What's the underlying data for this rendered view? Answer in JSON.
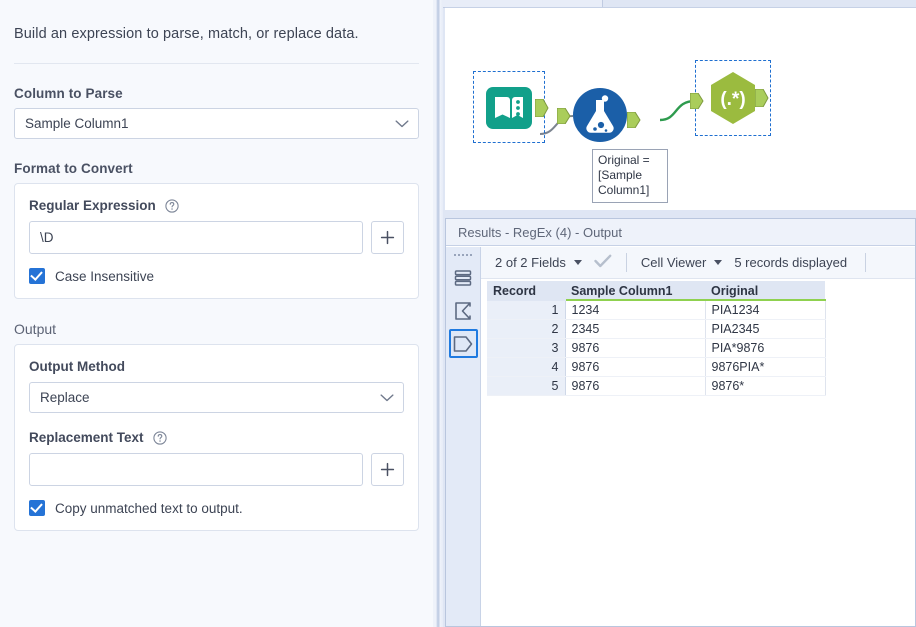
{
  "config_panel": {
    "intro_text": "Build an expression to parse, match, or replace data.",
    "column_to_parse": {
      "label": "Column to Parse",
      "value": "Sample Column1",
      "chevron_icon": "chevron-down-icon"
    },
    "format_to_convert": {
      "label": "Format to Convert",
      "regular_expression": {
        "label": "Regular Expression",
        "help_icon": "help-circle-icon",
        "value": "\\D",
        "placeholder": "",
        "add_button_icon": "plus-icon"
      },
      "case_insensitive": {
        "label": "Case Insensitive",
        "checked": true
      }
    },
    "output": {
      "label": "Output",
      "output_method": {
        "label": "Output Method",
        "value": "Replace",
        "chevron_icon": "chevron-down-icon"
      },
      "replacement_text": {
        "label": "Replacement Text",
        "help_icon": "help-circle-icon",
        "value": "",
        "placeholder": "",
        "add_button_icon": "plus-icon"
      },
      "copy_unmatched": {
        "label": "Copy unmatched text to output.",
        "checked": true
      }
    }
  },
  "canvas": {
    "nodes": [
      {
        "id": "text-input",
        "name": "text-input-node",
        "icon": "book-icon",
        "selected": true
      },
      {
        "id": "formula",
        "name": "formula-node",
        "icon": "flask-icon",
        "selected": false
      },
      {
        "id": "regex",
        "name": "regex-node",
        "icon": "regex-icon",
        "glyph": "(.*)",
        "selected": true
      }
    ],
    "annotation": {
      "text": "Original =\n[Sample\nColumn1]"
    }
  },
  "results": {
    "title": "Results - RegEx (4) - Output",
    "rail": [
      {
        "name": "grip-handle",
        "icon": "grip-dots-icon"
      },
      {
        "name": "data-rows-button",
        "icon": "rows-icon",
        "active": false
      },
      {
        "name": "summary-button",
        "icon": "sigma-icon",
        "active": false
      },
      {
        "name": "output-button",
        "icon": "output-shape-icon",
        "active": true
      }
    ],
    "toolbar": {
      "fields_label": "2 of 2 Fields",
      "fields_caret_icon": "caret-down-icon",
      "check_icon": "checkmark-icon",
      "viewer_label": "Cell Viewer",
      "viewer_caret_icon": "caret-down-icon",
      "records_label": "5 records displayed"
    },
    "table": {
      "columns": [
        "Record",
        "Sample Column1",
        "Original"
      ],
      "rows": [
        {
          "record": "1",
          "sample_column1": "1234",
          "original": "PIA1234"
        },
        {
          "record": "2",
          "sample_column1": "2345",
          "original": "PIA2345"
        },
        {
          "record": "3",
          "sample_column1": "9876",
          "original": "PIA*9876"
        },
        {
          "record": "4",
          "sample_column1": "9876",
          "original": "9876PIA*"
        },
        {
          "record": "5",
          "sample_column1": "9876",
          "original": "9876*"
        }
      ]
    }
  },
  "colors": {
    "accent_blue": "#2573d6",
    "selection_blue": "#1f6fd0",
    "node_teal": "#12a08a",
    "node_blue": "#1b5fa8",
    "node_green": "#9bbb3f",
    "header_underline_green": "#8fd14f"
  }
}
